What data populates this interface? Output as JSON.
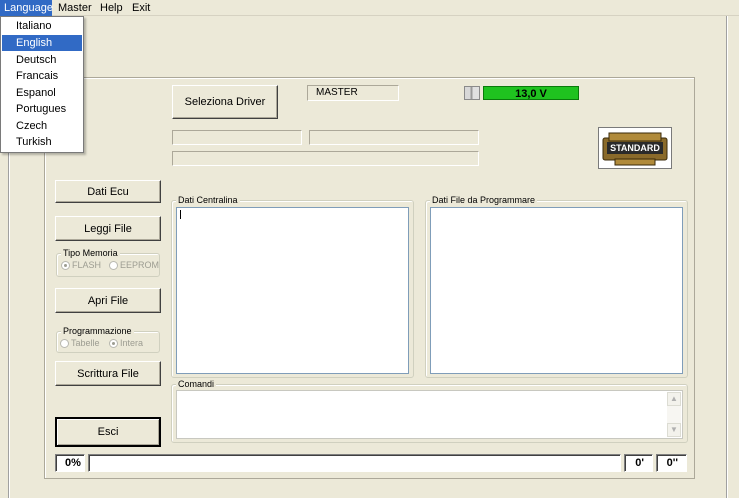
{
  "menu": {
    "language": "Language",
    "master": "Master",
    "help": "Help",
    "exit": "Exit"
  },
  "language_menu": [
    "Italiano",
    "English",
    "Deutsch",
    "Francais",
    "Espanol",
    "Portugues",
    "Czech",
    "Turkish"
  ],
  "selected_language": "English",
  "header": {
    "select_driver": "Seleziona Driver",
    "master_field": "MASTER",
    "voltage": "13,0 V",
    "standard_badge": "STANDARD"
  },
  "buttons": {
    "dati_ecu": "Dati Ecu",
    "leggi_file": "Leggi File",
    "apri_file": "Apri File",
    "scrittura_file": "Scrittura File",
    "esci": "Esci"
  },
  "memory_type": {
    "title": "Tipo Memoria",
    "options": [
      "FLASH",
      "EEPROM"
    ],
    "selected": "FLASH"
  },
  "programming": {
    "title": "Programmazione",
    "options": [
      "Tabelle",
      "Intera"
    ],
    "selected": "Intera"
  },
  "groups": {
    "dati_centralina": "Dati Centralina",
    "dati_file": "Dati File da Programmare",
    "comandi": "Comandi"
  },
  "status": {
    "progress": "0%",
    "progress_value": 0,
    "time1": "0'",
    "time2": "0''"
  },
  "colors": {
    "window_bg": "#ece9d8",
    "highlight": "#316ac5",
    "voltage_ok": "#1fc21f"
  }
}
